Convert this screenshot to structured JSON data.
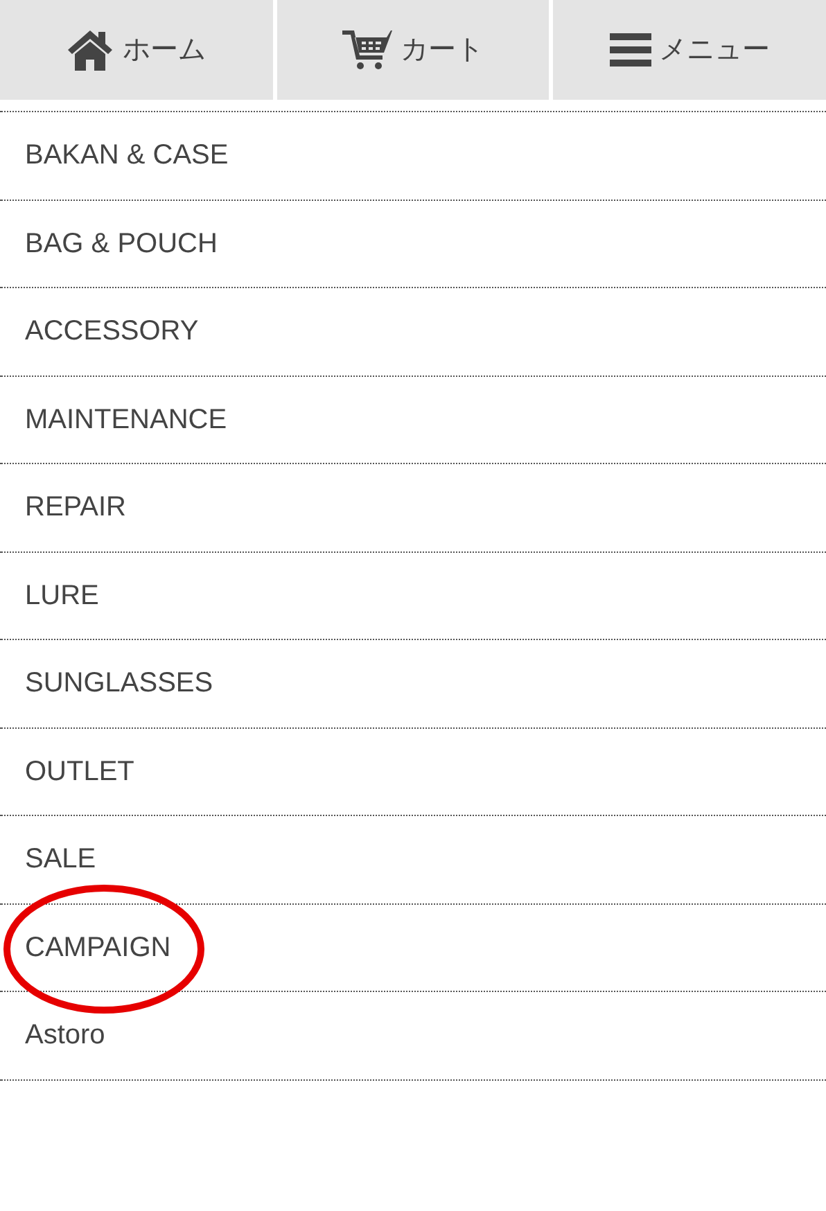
{
  "nav": [
    {
      "kind": "home",
      "label": "ホーム"
    },
    {
      "kind": "cart",
      "label": "カート"
    },
    {
      "kind": "menu",
      "label": "メニュー"
    }
  ],
  "menu_items": [
    {
      "label": "BAKAN & CASE",
      "circled": false
    },
    {
      "label": "BAG & POUCH",
      "circled": false
    },
    {
      "label": "ACCESSORY",
      "circled": false
    },
    {
      "label": "MAINTENANCE",
      "circled": false
    },
    {
      "label": "REPAIR",
      "circled": false
    },
    {
      "label": "LURE",
      "circled": false
    },
    {
      "label": "SUNGLASSES",
      "circled": false
    },
    {
      "label": "OUTLET",
      "circled": false
    },
    {
      "label": "SALE",
      "circled": false
    },
    {
      "label": "CAMPAIGN",
      "circled": true
    },
    {
      "label": "Astoro",
      "circled": false
    }
  ]
}
